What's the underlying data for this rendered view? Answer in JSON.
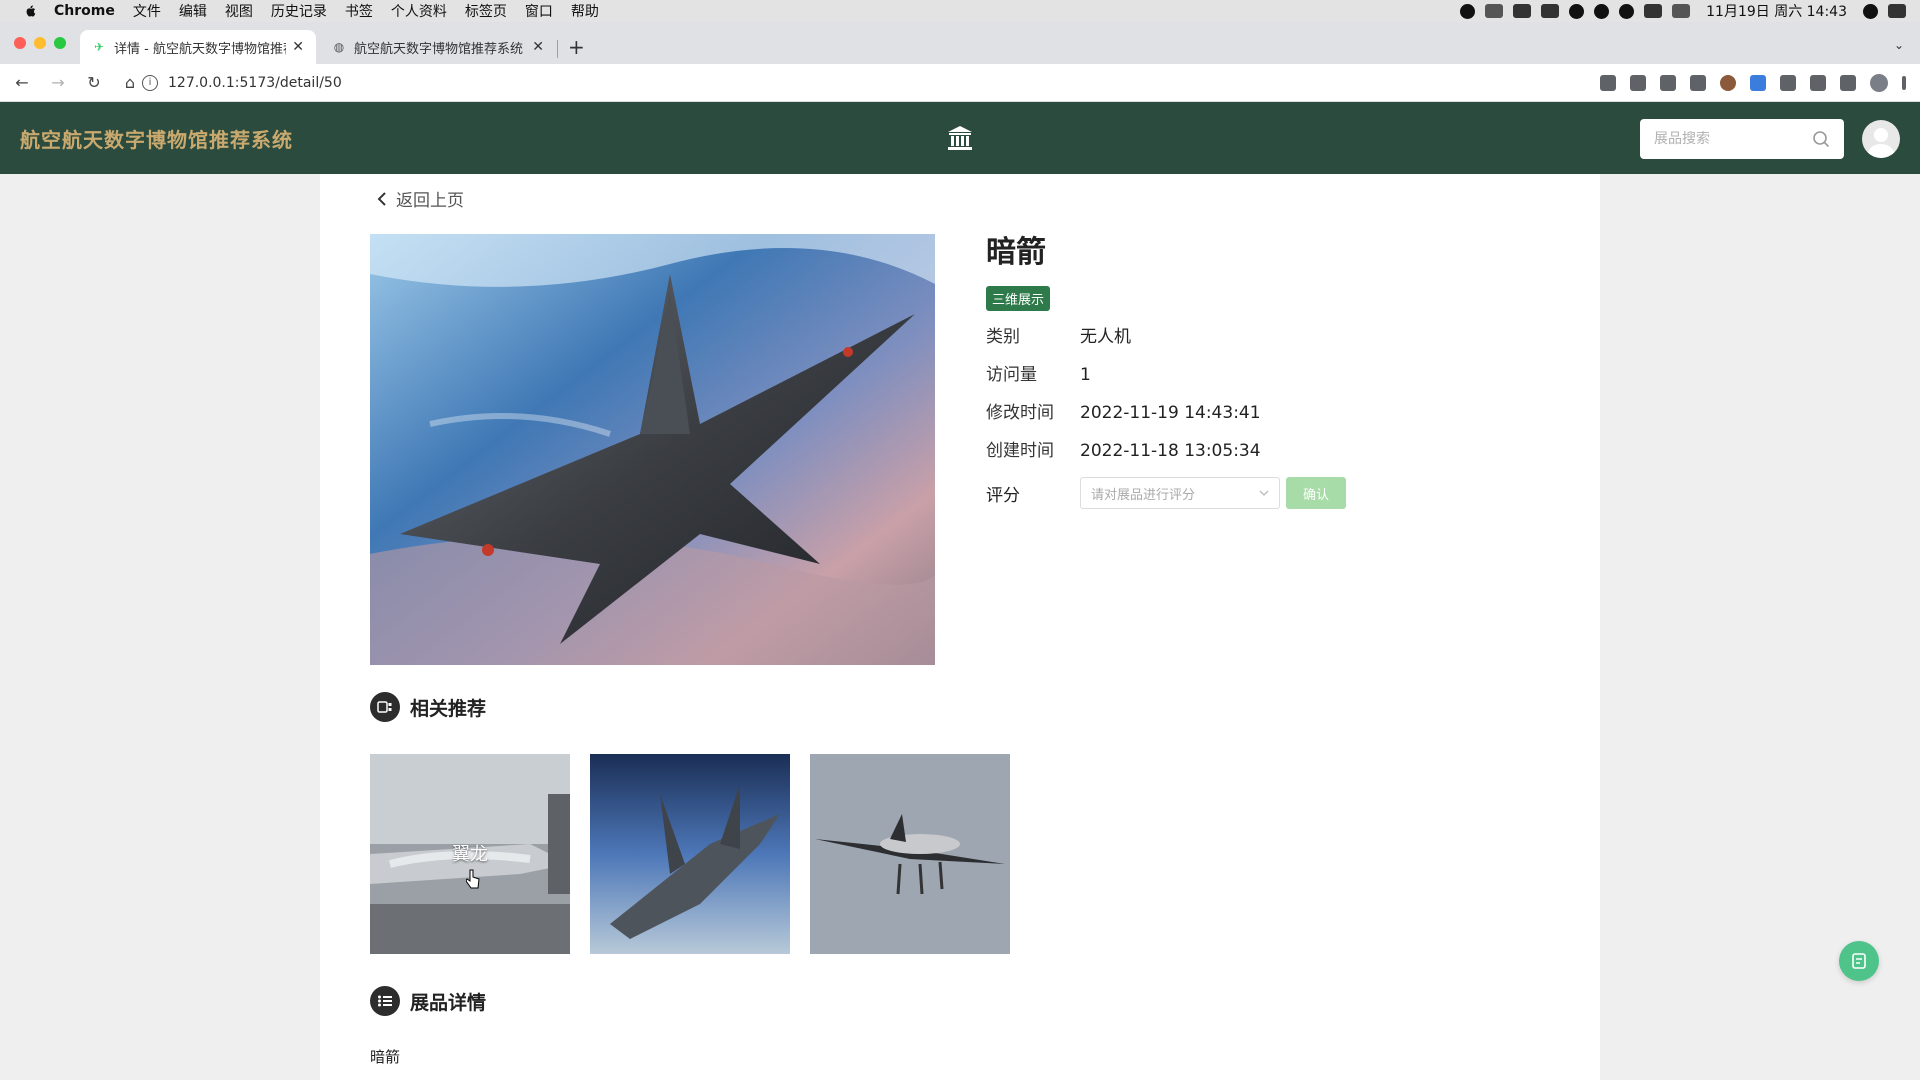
{
  "menubar": {
    "app": "Chrome",
    "items": [
      "文件",
      "编辑",
      "视图",
      "历史记录",
      "书签",
      "个人资料",
      "标签页",
      "窗口",
      "帮助"
    ],
    "clock": "11月19日 周六 14:43"
  },
  "browser": {
    "tabs": [
      {
        "title": "详情 - 航空航天数字博物馆推荐",
        "active": true
      },
      {
        "title": "航空航天数字博物馆推荐系统 后",
        "active": false
      }
    ],
    "new_tab_label": "+",
    "url": "127.0.0.1:5173/detail/50"
  },
  "header": {
    "brand": "航空航天数字博物馆推荐系统",
    "search_placeholder": "展品搜索"
  },
  "detail": {
    "back_label": "返回上页",
    "title": "暗箭",
    "tag": "三维展示",
    "fields": [
      {
        "label": "类别",
        "value": "无人机"
      },
      {
        "label": "访问量",
        "value": "1"
      },
      {
        "label": "修改时间",
        "value": "2022-11-19 14:43:41"
      },
      {
        "label": "创建时间",
        "value": "2022-11-18 13:05:34"
      }
    ],
    "rating_label": "评分",
    "rating_placeholder": "请对展品进行评分",
    "confirm_label": "确认"
  },
  "related": {
    "heading": "相关推荐",
    "items": [
      {
        "caption": "翼龙"
      },
      {
        "caption": ""
      },
      {
        "caption": ""
      }
    ]
  },
  "exhibit_detail": {
    "heading": "展品详情",
    "text": "暗箭"
  },
  "colors": {
    "header_bg": "#2a4b3e",
    "brand_text": "#c9a96e",
    "tag_bg": "#2f7a4a",
    "confirm_bg": "#a7dba7",
    "float_btn": "#4ec38a"
  }
}
